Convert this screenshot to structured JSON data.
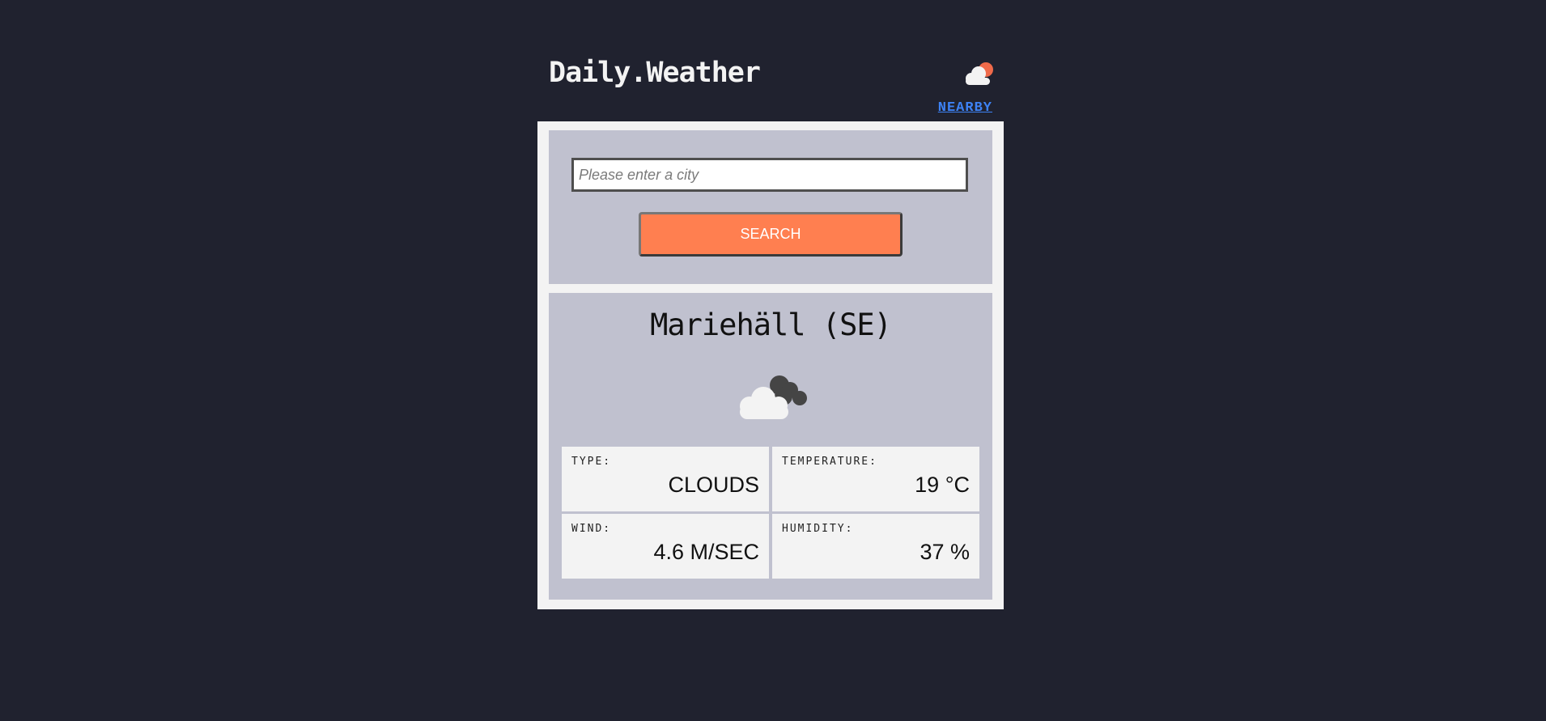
{
  "header": {
    "logo": "Daily.Weather",
    "logo_icon": "cloud-sun-icon",
    "nearby_link": "NEARBY"
  },
  "search": {
    "placeholder": "Please enter a city",
    "value": "",
    "button_label": "SEARCH"
  },
  "result": {
    "city": "Mariehäll (SE)",
    "weather_icon": "clouds-icon",
    "stats": {
      "type_label": "TYPE:",
      "type_value": "CLOUDS",
      "temperature_label": "TEMPERATURE:",
      "temperature_value": "19 °C",
      "wind_label": "WIND:",
      "wind_value": "4.6 M/SEC",
      "humidity_label": "HUMIDITY:",
      "humidity_value": "37 %"
    }
  },
  "colors": {
    "background": "#20222f",
    "panel": "#c0c1cf",
    "frame": "#f3f3f3",
    "accent": "#ff7f50",
    "link": "#3d82f5"
  }
}
